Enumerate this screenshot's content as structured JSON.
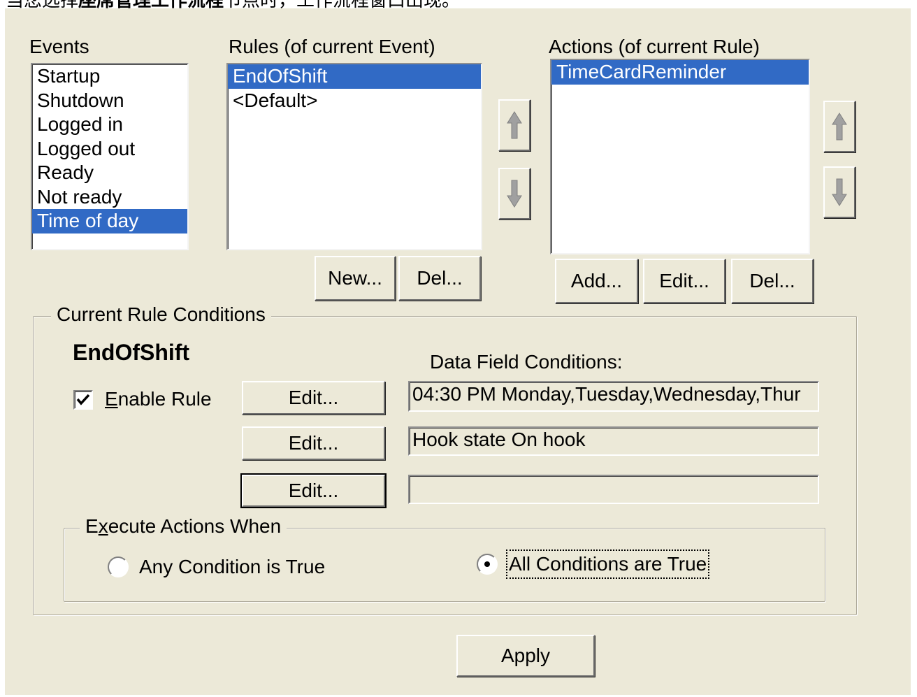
{
  "caption": {
    "prefix": "当您选择",
    "bold": "座席管理工作流程",
    "suffix": "节点时，工作流程窗口出现。"
  },
  "events": {
    "label": "Events",
    "items": [
      "Startup",
      "Shutdown",
      "Logged in",
      "Logged out",
      "Ready",
      "Not ready",
      "Time of day"
    ],
    "selected": "Time of day"
  },
  "rules": {
    "label": "Rules (of current Event)",
    "items": [
      "EndOfShift",
      "<Default>"
    ],
    "selected": "EndOfShift",
    "new_label": "New...",
    "del_label": "Del..."
  },
  "actions": {
    "label": "Actions (of current Rule)",
    "items": [
      "TimeCardReminder"
    ],
    "selected": "TimeCardReminder",
    "add_label": "Add...",
    "edit_label": "Edit...",
    "del_label": "Del..."
  },
  "conditions": {
    "group_label": "Current Rule Conditions",
    "rule_name": "EndOfShift",
    "enable_rule_prefix": "",
    "enable_rule_accel": "E",
    "enable_rule_rest": "nable Rule",
    "enable_checked": true,
    "data_field_label": "Data Field Conditions:",
    "rows": [
      {
        "edit_label": "Edit...",
        "value": "04:30 PM Monday,Tuesday,Wednesday,Thur"
      },
      {
        "edit_label": "Edit...",
        "value": "Hook state On hook"
      },
      {
        "edit_label": "Edit...",
        "value": ""
      }
    ]
  },
  "execute": {
    "label_prefix": "E",
    "label_accel": "x",
    "label_rest": "ecute Actions When",
    "any_label": "Any Condition is True",
    "all_label": "All Conditions are True",
    "selected": "all"
  },
  "apply_label": "Apply",
  "colors": {
    "selection": "#316ac5",
    "dialog": "#ece9d8"
  }
}
